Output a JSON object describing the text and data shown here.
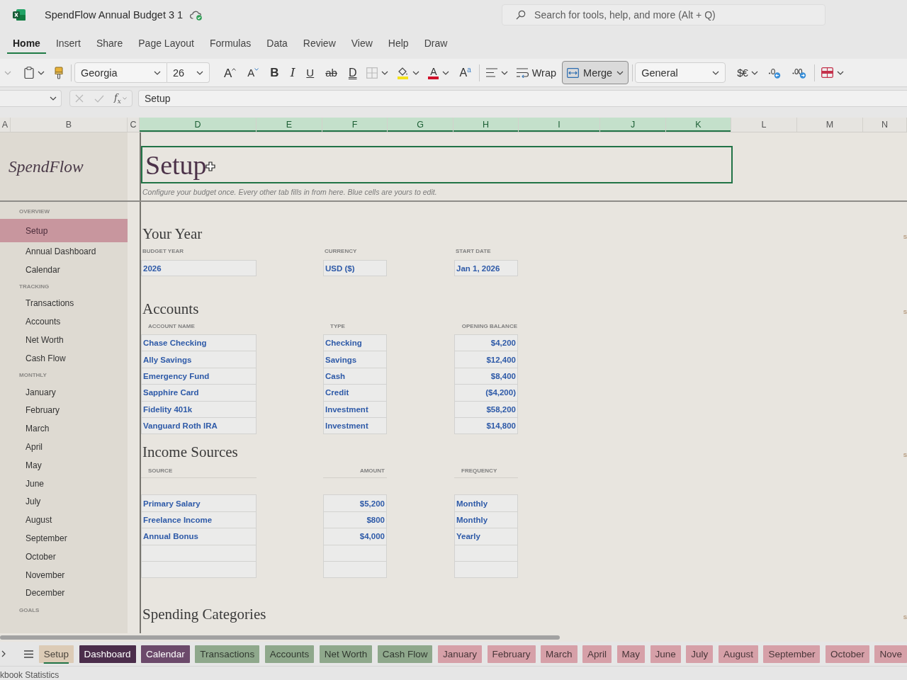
{
  "app_bar": {
    "title": "SpendFlow Annual Budget 3 1",
    "search": {
      "placeholder": "Search for tools, help, and more (Alt + Q)"
    }
  },
  "ribbon_tabs": [
    {
      "label": "Home",
      "selected": true
    },
    {
      "label": "Insert",
      "selected": false
    },
    {
      "label": "Share",
      "selected": false
    },
    {
      "label": "Page Layout",
      "selected": false
    },
    {
      "label": "Formulas",
      "selected": false
    },
    {
      "label": "Data",
      "selected": false
    },
    {
      "label": "Review",
      "selected": false
    },
    {
      "label": "View",
      "selected": false
    },
    {
      "label": "Help",
      "selected": false
    },
    {
      "label": "Draw",
      "selected": false
    }
  ],
  "toolbar": {
    "groups": [
      [
        {
          "kind": "paste",
          "dropdown": true,
          "pressed": false
        },
        {
          "kind": "format_painter",
          "dropdown": false,
          "pressed": false
        }
      ],
      [
        {
          "kind": "font_name",
          "value": "Georgia",
          "dropdown": true
        },
        {
          "kind": "font_size",
          "value": "26",
          "dropdown": true
        },
        {
          "kind": "grow",
          "text": "A",
          "dropdown": false,
          "pressed": false
        },
        {
          "kind": "shrink",
          "text": "A",
          "dropdown": false,
          "pressed": false
        },
        {
          "kind": "bold",
          "text": "B",
          "dropdown": false,
          "pressed": false
        },
        {
          "kind": "italic",
          "text": "I",
          "dropdown": false,
          "pressed": false
        },
        {
          "kind": "underline",
          "text": "U",
          "dropdown": false,
          "pressed": false
        },
        {
          "kind": "strike",
          "text": "ab",
          "dropdown": false,
          "pressed": false
        },
        {
          "kind": "double_underline",
          "text": "D",
          "dropdown": false,
          "pressed": false
        },
        {
          "kind": "borders",
          "dropdown": true,
          "pressed": false
        },
        {
          "kind": "fill_color",
          "dropdown": true,
          "pressed": false
        },
        {
          "kind": "font_color",
          "text": "A",
          "dropdown": true,
          "pressed": false
        },
        {
          "kind": "text_effects",
          "text": "A$^{a}$",
          "dropdown": false,
          "pressed": false
        }
      ],
      [
        {
          "kind": "align",
          "dropdown": true,
          "pressed": false
        },
        {
          "kind": "wrap",
          "text": "Wrap",
          "dropdown": false,
          "pressed": false
        },
        {
          "kind": "merge",
          "text": "Merge",
          "dropdown": true,
          "pressed": true
        }
      ],
      [
        {
          "kind": "number_format",
          "value": "General",
          "dropdown": true
        },
        {
          "kind": "currency",
          "text": "$€",
          "dropdown": true,
          "pressed": false
        },
        {
          "kind": "decrease_decimals",
          "dropdown": false,
          "pressed": false
        },
        {
          "kind": "increase_decimals",
          "dropdown": false,
          "pressed": false
        }
      ],
      [
        {
          "kind": "conditional_format",
          "dropdown": true,
          "pressed": false
        }
      ]
    ]
  },
  "formula_bar": {
    "buttons": [
      {
        "kind": "cancel",
        "disabled": true
      },
      {
        "kind": "enter",
        "disabled": true
      },
      {
        "kind": "function",
        "text": "f$_{x}$",
        "disabled": false
      }
    ],
    "formula": "Setup"
  },
  "column_headers": [
    {
      "label": "A",
      "selected": false
    },
    {
      "label": "B",
      "selected": false
    },
    {
      "label": "C",
      "selected": false
    },
    {
      "label": "D",
      "selected": true
    },
    {
      "label": "E",
      "selected": true
    },
    {
      "label": "F",
      "selected": true
    },
    {
      "label": "G",
      "selected": true
    },
    {
      "label": "H",
      "selected": true
    },
    {
      "label": "I",
      "selected": true
    },
    {
      "label": "J",
      "selected": true
    },
    {
      "label": "K",
      "selected": true
    },
    {
      "label": "L",
      "selected": false
    },
    {
      "label": "M",
      "selected": false
    },
    {
      "label": "N",
      "selected": false
    }
  ],
  "sidebar": {
    "logo": "SpendFlow",
    "sections": [
      {
        "heading": "OVERVIEW",
        "items": [
          {
            "label": "Setup",
            "selected": true
          },
          {
            "label": "Annual Dashboard",
            "selected": false
          },
          {
            "label": "Calendar",
            "selected": false
          }
        ]
      },
      {
        "heading": "TRACKING",
        "items": [
          {
            "label": "Transactions",
            "selected": false
          },
          {
            "label": "Accounts",
            "selected": false
          },
          {
            "label": "Net Worth",
            "selected": false
          },
          {
            "label": "Cash Flow",
            "selected": false
          }
        ]
      },
      {
        "heading": "MONTHLY",
        "items": [
          {
            "label": "January",
            "selected": false
          },
          {
            "label": "February",
            "selected": false
          },
          {
            "label": "March",
            "selected": false
          },
          {
            "label": "April",
            "selected": false
          },
          {
            "label": "May",
            "selected": false
          },
          {
            "label": "June",
            "selected": false
          },
          {
            "label": "July",
            "selected": false
          },
          {
            "label": "August",
            "selected": false
          },
          {
            "label": "September",
            "selected": false
          },
          {
            "label": "October",
            "selected": false
          },
          {
            "label": "November",
            "selected": false
          },
          {
            "label": "December",
            "selected": false
          }
        ]
      },
      {
        "heading": "GOALS"
      }
    ]
  },
  "sheet": {
    "title": "Setup",
    "subtitle": "Configure your budget once. Every other tab fills in from here. Blue cells are yours to edit.",
    "sections": [
      {
        "kind": "fields",
        "heading": "Your Year",
        "edge_note": "S",
        "fields": [
          {
            "label": "BUDGET YEAR",
            "value": "2026"
          },
          {
            "label": "CURRENCY",
            "value": "USD ($)"
          },
          {
            "label": "START DATE",
            "value": "Jan 1, 2026"
          }
        ]
      },
      {
        "kind": "table",
        "heading": "Accounts",
        "edge_note": "S",
        "header_rule": false,
        "columns": [
          {
            "label": "ACCOUNT NAME",
            "kind": "text"
          },
          {
            "label": "TYPE",
            "kind": "text"
          },
          {
            "label": "OPENING BALANCE",
            "kind": "amount"
          }
        ],
        "rows": [
          {
            "kind": "entry",
            "cells": [
              "Chase Checking",
              "Checking",
              "$4,200"
            ]
          },
          {
            "kind": "entry",
            "cells": [
              "Ally Savings",
              "Savings",
              "$12,400"
            ]
          },
          {
            "kind": "entry",
            "cells": [
              "Emergency Fund",
              "Cash",
              "$8,400"
            ]
          },
          {
            "kind": "entry",
            "cells": [
              "Sapphire Card",
              "Credit",
              "($4,200)"
            ]
          },
          {
            "kind": "entry",
            "cells": [
              "Fidelity 401k",
              "Investment",
              "$58,200"
            ]
          },
          {
            "kind": "entry",
            "cells": [
              "Vanguard Roth IRA",
              "Investment",
              "$14,800"
            ]
          }
        ]
      },
      {
        "kind": "table",
        "heading": "Income Sources",
        "edge_note": "S",
        "header_rule": true,
        "columns": [
          {
            "label": "SOURCE",
            "kind": "text"
          },
          {
            "label": "AMOUNT",
            "kind": "amount"
          },
          {
            "label": "FREQUENCY",
            "kind": "text"
          }
        ],
        "rows": [
          {
            "kind": "entry",
            "cells": [
              "Primary Salary",
              "$5,200",
              "Monthly"
            ]
          },
          {
            "kind": "entry",
            "cells": [
              "Freelance Income",
              "$800",
              "Monthly"
            ]
          },
          {
            "kind": "entry",
            "cells": [
              "Annual Bonus",
              "$4,000",
              "Yearly"
            ]
          },
          {
            "kind": "blank"
          },
          {
            "kind": "blank"
          }
        ]
      },
      {
        "kind": "table",
        "heading": "Spending Categories",
        "edge_note": "S"
      }
    ]
  },
  "sheet_tabs": [
    {
      "label": "Setup",
      "selected": true,
      "color": "#dccbb6"
    },
    {
      "label": "Dashboard",
      "selected": false,
      "color": "#4b2d4b"
    },
    {
      "label": "Calendar",
      "selected": false,
      "color": "#6c4a6b"
    },
    {
      "label": "Transactions",
      "selected": false,
      "color": "#8fa88c"
    },
    {
      "label": "Accounts",
      "selected": false,
      "color": "#8fa88c"
    },
    {
      "label": "Net Worth",
      "selected": false,
      "color": "#8fa88c"
    },
    {
      "label": "Cash Flow",
      "selected": false,
      "color": "#8fa88c"
    },
    {
      "label": "January",
      "selected": false,
      "color": "#d6a0a8"
    },
    {
      "label": "February",
      "selected": false,
      "color": "#d6a0a8"
    },
    {
      "label": "March",
      "selected": false,
      "color": "#d6a0a8"
    },
    {
      "label": "April",
      "selected": false,
      "color": "#d6a0a8"
    },
    {
      "label": "May",
      "selected": false,
      "color": "#d6a0a8"
    },
    {
      "label": "June",
      "selected": false,
      "color": "#d6a0a8"
    },
    {
      "label": "July",
      "selected": false,
      "color": "#d6a0a8"
    },
    {
      "label": "August",
      "selected": false,
      "color": "#d6a0a8"
    },
    {
      "label": "September",
      "selected": false,
      "color": "#d6a0a8"
    },
    {
      "label": "October",
      "selected": false,
      "color": "#d6a0a8"
    },
    {
      "label": "Nove",
      "selected": false,
      "color": "#d6a0a8"
    }
  ],
  "status_bar": {
    "text": "kbook Statistics"
  }
}
